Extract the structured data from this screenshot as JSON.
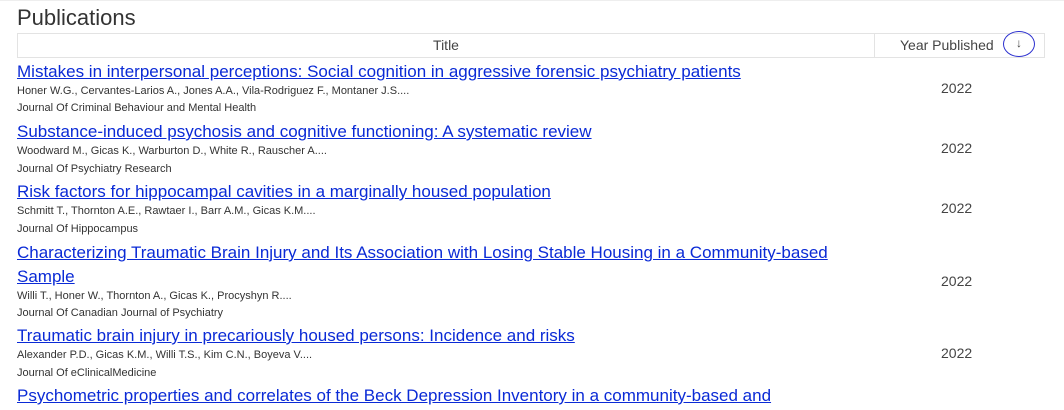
{
  "section": {
    "title": "Publications"
  },
  "table": {
    "columns": {
      "title": "Title",
      "year": "Year Published"
    },
    "sort": {
      "column": "Year Published",
      "direction": "descending",
      "icon": "arrow-down-icon",
      "glyph": "↓"
    }
  },
  "publications": [
    {
      "title": "Mistakes in interpersonal perceptions: Social cognition in aggressive forensic psychiatry patients",
      "authors": "Honer W.G., Cervantes-Larios A., Jones A.A., Vila-Rodriguez F., Montaner J.S....",
      "journal": "Journal Of Criminal Behaviour and Mental Health",
      "year": "2022"
    },
    {
      "title": "Substance-induced psychosis and cognitive functioning: A systematic review",
      "authors": "Woodward M., Gicas K., Warburton D., White R., Rauscher A....",
      "journal": "Journal Of Psychiatry Research",
      "year": "2022"
    },
    {
      "title": "Risk factors for hippocampal cavities in a marginally housed population",
      "authors": "Schmitt T., Thornton A.E., Rawtaer I., Barr A.M., Gicas K.M....",
      "journal": "Journal Of Hippocampus",
      "year": "2022"
    },
    {
      "title": "Characterizing Traumatic Brain Injury and Its Association with Losing Stable Housing in a Community-based Sample",
      "authors": "Willi T., Honer W., Thornton A., Gicas K., Procyshyn R....",
      "journal": "Journal Of Canadian Journal of Psychiatry",
      "year": "2022"
    },
    {
      "title": "Traumatic brain injury in precariously housed persons: Incidence and risks",
      "authors": "Alexander P.D., Gicas K.M., Willi T.S., Kim C.N., Boyeva V....",
      "journal": "Journal Of eClinicalMedicine",
      "year": "2022"
    },
    {
      "title": "Psychometric properties and correlates of the Beck Depression Inventory in a community-based and",
      "authors": "",
      "journal": "",
      "year": ""
    }
  ]
}
